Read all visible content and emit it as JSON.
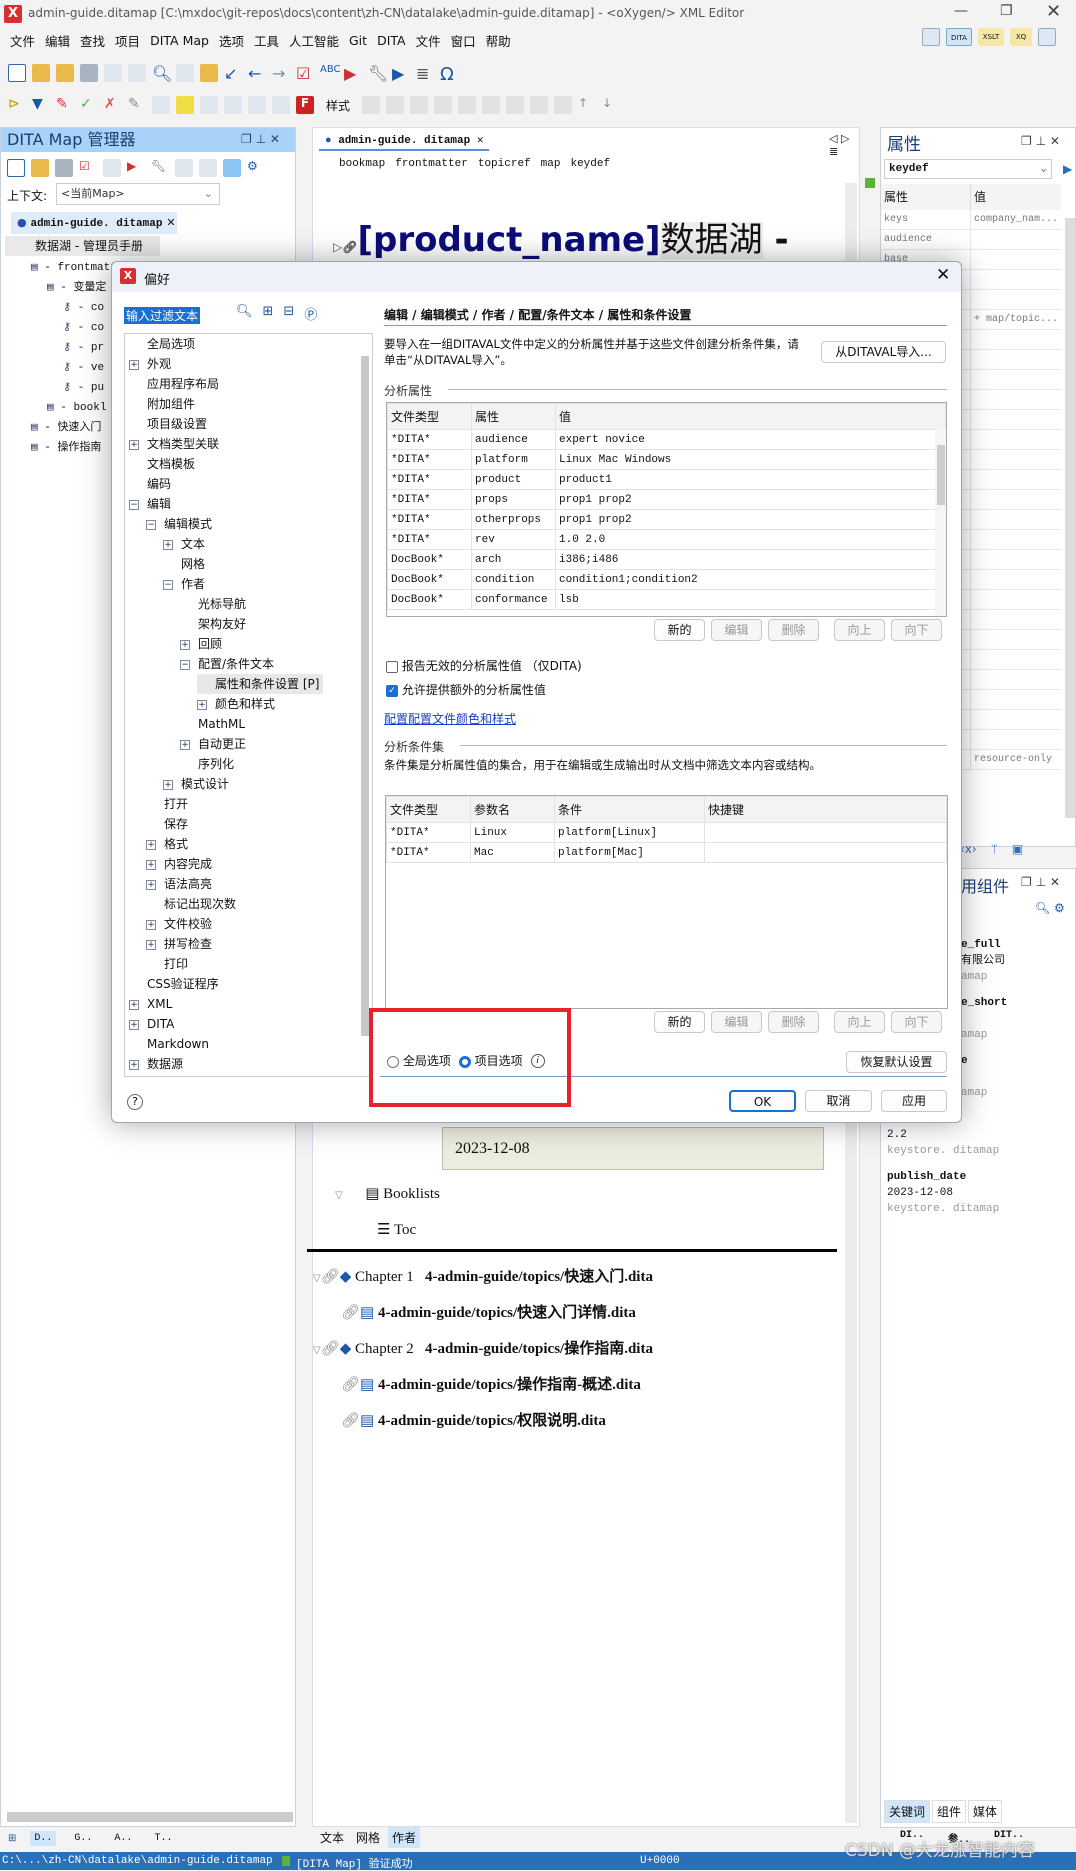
{
  "window": {
    "title": "admin-guide.ditamap [C:\\mxdoc\\git-repos\\docs\\content\\zh-CN\\datalake\\admin-guide.ditamap] - <oXygen/> XML Editor",
    "logo": "X"
  },
  "menu": [
    "文件",
    "编辑",
    "查找",
    "项目",
    "DITA Map",
    "选项",
    "工具",
    "人工智能",
    "Git",
    "DITA",
    "文件",
    "窗口",
    "帮助"
  ],
  "perspectives": [
    "DITA",
    "XSLT",
    "XQ"
  ],
  "toolbar2": {
    "styles_label": "样式"
  },
  "left_panel": {
    "title": "DITA Map 管理器",
    "context_label": "上下文:",
    "context_value": "<当前Map>",
    "tab": "admin-guide. ditamap",
    "root": "数据湖 - 管理员手册",
    "tree": [
      {
        "label": "frontmatt",
        "indent": 1
      },
      {
        "label": "变量定",
        "indent": 2
      },
      {
        "label": "co",
        "indent": 3
      },
      {
        "label": "co",
        "indent": 3
      },
      {
        "label": "pr",
        "indent": 3
      },
      {
        "label": "ve",
        "indent": 3
      },
      {
        "label": "pu",
        "indent": 3
      },
      {
        "label": "bookl",
        "indent": 2
      },
      {
        "label": "快速入门",
        "indent": 1
      },
      {
        "label": "操作指南",
        "indent": 1
      }
    ],
    "bottom_tabs": [
      "D..",
      "G..",
      "A..",
      "T.."
    ]
  },
  "editor": {
    "tab": "admin-guide. ditamap",
    "breadcrumb": [
      "bookmap",
      "frontmatter",
      "topicref",
      "map",
      "keydef"
    ],
    "heading_key": "[product_name]",
    "heading_text": "数据湖",
    "heading_tail": "-",
    "date": "2023-12-08",
    "booklists": "Booklists",
    "toc": "Toc",
    "chapters": [
      {
        "prefix": "Chapter  1",
        "path": "4-admin-guide/topics/快速入门.dita",
        "children": [
          "4-admin-guide/topics/快速入门详情.dita"
        ]
      },
      {
        "prefix": "Chapter  2",
        "path": "4-admin-guide/topics/操作指南.dita",
        "children": [
          "4-admin-guide/topics/操作指南-概述.dita",
          "4-admin-guide/topics/权限说明.dita"
        ]
      }
    ],
    "bottom_tabs": [
      "文本",
      "网格",
      "作者"
    ],
    "active_tab": "作者"
  },
  "right_panel": {
    "title": "属性",
    "element": "keydef",
    "col_attr": "属性",
    "col_value": "值",
    "rows": [
      {
        "attr": "keys",
        "value": "company_nam..."
      },
      {
        "attr": "audience",
        "value": ""
      },
      {
        "attr": "base",
        "value": ""
      },
      {
        "attr": "",
        "value": "+ map/topic..."
      },
      {
        "attr": "",
        "value": "resource-only"
      }
    ],
    "components_title": "用组件",
    "keys": [
      {
        "name": "e_full",
        "value": "有限公司",
        "source": "amap"
      },
      {
        "name": "e_short",
        "value": "",
        "source": "amap"
      },
      {
        "name": "e",
        "value": "",
        "source": "amap"
      },
      {
        "name": "ber",
        "value": "2.2",
        "source": "keystore. ditamap"
      },
      {
        "name": "publish_date",
        "value": "2023-12-08",
        "source": "keystore. ditamap"
      }
    ],
    "bottom_tabs": [
      "关键词",
      "组件",
      "媒体"
    ],
    "bottom_views": [
      "DI..",
      "参..",
      "DIT.."
    ]
  },
  "dialog": {
    "title": "偏好",
    "filter_placeholder": "输入过滤文本",
    "tree": [
      {
        "label": "全局选项",
        "level": 0,
        "exp": ""
      },
      {
        "label": "外观",
        "level": 0,
        "exp": "+"
      },
      {
        "label": "应用程序布局",
        "level": 0,
        "exp": ""
      },
      {
        "label": "附加组件",
        "level": 0,
        "exp": ""
      },
      {
        "label": "项目级设置",
        "level": 0,
        "exp": ""
      },
      {
        "label": "文档类型关联",
        "level": 0,
        "exp": "+"
      },
      {
        "label": "文档模板",
        "level": 0,
        "exp": ""
      },
      {
        "label": "编码",
        "level": 0,
        "exp": ""
      },
      {
        "label": "编辑",
        "level": 0,
        "exp": "-"
      },
      {
        "label": "编辑模式",
        "level": 1,
        "exp": "-"
      },
      {
        "label": "文本",
        "level": 2,
        "exp": "+"
      },
      {
        "label": "网格",
        "level": 2,
        "exp": ""
      },
      {
        "label": "作者",
        "level": 2,
        "exp": "-"
      },
      {
        "label": "光标导航",
        "level": 3,
        "exp": ""
      },
      {
        "label": "架构友好",
        "level": 3,
        "exp": ""
      },
      {
        "label": "回顾",
        "level": 3,
        "exp": "+"
      },
      {
        "label": "配置/条件文本",
        "level": 3,
        "exp": "-"
      },
      {
        "label": "属性和条件设置 [P]",
        "level": 4,
        "exp": "",
        "selected": true
      },
      {
        "label": "颜色和样式",
        "level": 4,
        "exp": "+"
      },
      {
        "label": "MathML",
        "level": 3,
        "exp": ""
      },
      {
        "label": "自动更正",
        "level": 3,
        "exp": "+"
      },
      {
        "label": "序列化",
        "level": 3,
        "exp": ""
      },
      {
        "label": "模式设计",
        "level": 2,
        "exp": "+"
      },
      {
        "label": "打开",
        "level": 1,
        "exp": ""
      },
      {
        "label": "保存",
        "level": 1,
        "exp": ""
      },
      {
        "label": "格式",
        "level": 1,
        "exp": "+"
      },
      {
        "label": "内容完成",
        "level": 1,
        "exp": "+"
      },
      {
        "label": "语法高亮",
        "level": 1,
        "exp": "+"
      },
      {
        "label": "标记出现次数",
        "level": 1,
        "exp": ""
      },
      {
        "label": "文件校验",
        "level": 1,
        "exp": "+"
      },
      {
        "label": "拼写检查",
        "level": 1,
        "exp": "+"
      },
      {
        "label": "打印",
        "level": 1,
        "exp": ""
      },
      {
        "label": "CSS验证程序",
        "level": 0,
        "exp": ""
      },
      {
        "label": "XML",
        "level": 0,
        "exp": "+"
      },
      {
        "label": "DITA",
        "level": 0,
        "exp": "+"
      },
      {
        "label": "Markdown",
        "level": 0,
        "exp": ""
      },
      {
        "label": "数据源",
        "level": 0,
        "exp": "+"
      }
    ],
    "breadcrumb": "编辑 / 编辑模式 / 作者 / 配置/条件文本 / 属性和条件设置",
    "intro": "要导入在一组DITAVAL文件中定义的分析属性并基于这些文件创建分析条件集，请单击“从DITAVAL导入”。",
    "import_button": "从DITAVAL导入...",
    "attrs_section": "分析属性",
    "attrs_columns": [
      "文件类型",
      "属性",
      "值"
    ],
    "attrs_rows": [
      [
        "*DITA*",
        "audience",
        "expert novice"
      ],
      [
        "*DITA*",
        "platform",
        "Linux Mac Windows"
      ],
      [
        "*DITA*",
        "product",
        "product1"
      ],
      [
        "*DITA*",
        "props",
        "prop1 prop2"
      ],
      [
        "*DITA*",
        "otherprops",
        "prop1 prop2"
      ],
      [
        "*DITA*",
        "rev",
        "1.0 2.0"
      ],
      [
        "DocBook*",
        "arch",
        "i386;i486"
      ],
      [
        "DocBook*",
        "condition",
        "condition1;condition2"
      ],
      [
        "DocBook*",
        "conformance",
        "lsb"
      ]
    ],
    "buttons": [
      "新的",
      "编辑",
      "删除",
      "向上",
      "向下"
    ],
    "check_report": {
      "label": "报告无效的分析属性值 （仅DITA)",
      "checked": false
    },
    "check_allow": {
      "label": "允许提供额外的分析属性值",
      "checked": true
    },
    "colors_link": "配置配置文件颜色和样式",
    "sets_section": "分析条件集",
    "sets_desc": "条件集是分析属性值的集合，用于在编辑或生成输出时从文档中筛选文本内容或结构。",
    "sets_columns": [
      "文件类型",
      "参数名",
      "条件",
      "快捷键"
    ],
    "sets_rows": [
      [
        "*DITA*",
        "Linux",
        "platform[Linux]",
        ""
      ],
      [
        "*DITA*",
        "Mac",
        "platform[Mac]",
        ""
      ]
    ],
    "radio_global": "全局选项",
    "radio_project": "项目选项",
    "selected_scope": "项目选项",
    "restore_defaults": "恢复默认设置",
    "ok": "OK",
    "cancel": "取消",
    "apply": "应用",
    "help": "?"
  },
  "status": {
    "path": "C:\\...\\zh-CN\\datalake\\admin-guide.ditamap",
    "validation": "[DITA Map] 验证成功",
    "unicode": "U+0000",
    "watermark": "CSDN @大龙涨智能内容"
  },
  "colors": {
    "accent": "#2a6fb8",
    "panel_header": "#a9d2f8",
    "highlight_box": "#e8212b",
    "heading": "#0c0c7a"
  }
}
